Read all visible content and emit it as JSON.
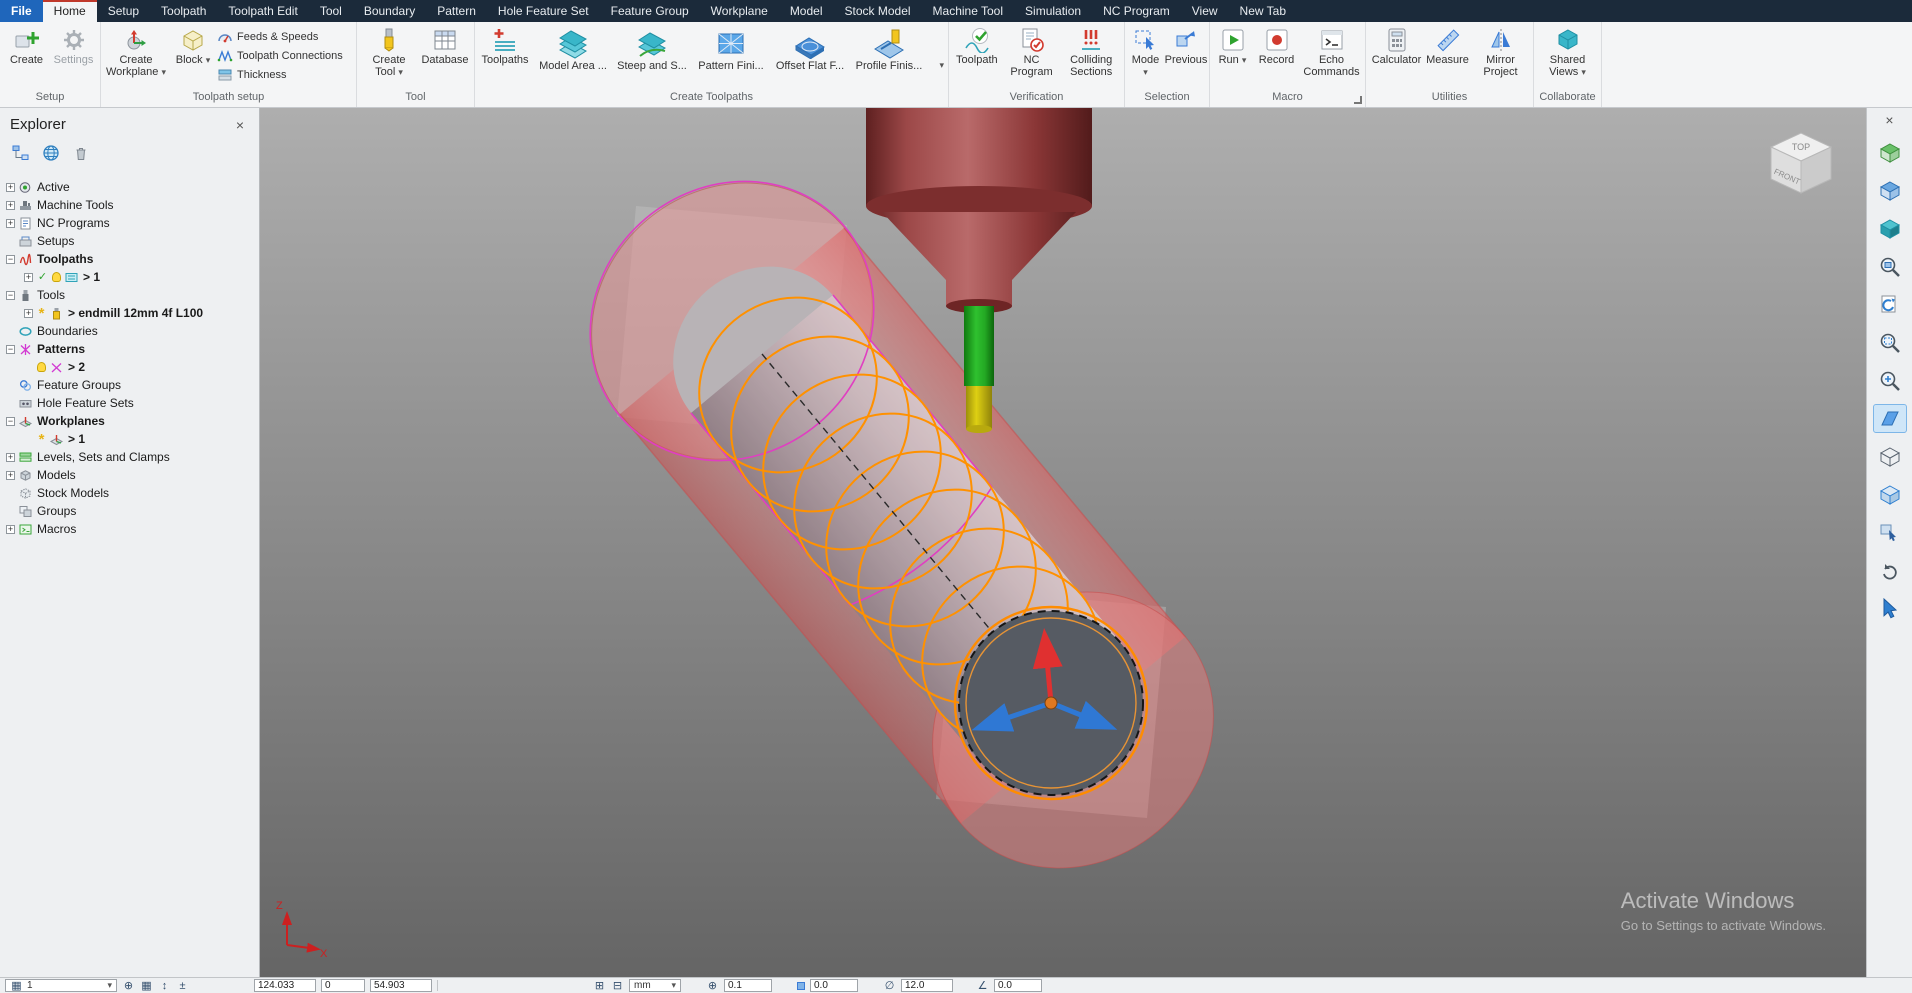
{
  "tab_bar": {
    "tabs": [
      "File",
      "Home",
      "Setup",
      "Toolpath",
      "Toolpath Edit",
      "Tool",
      "Boundary",
      "Pattern",
      "Hole Feature Set",
      "Feature Group",
      "Workplane",
      "Model",
      "Stock Model",
      "Machine Tool",
      "Simulation",
      "NC Program",
      "View",
      "New Tab"
    ]
  },
  "ribbon": {
    "groups": {
      "setup": {
        "label": "Setup"
      },
      "toolpath_setup": {
        "label": "Toolpath setup"
      },
      "tool": {
        "label": "Tool"
      },
      "create_toolpaths": {
        "label": "Create Toolpaths"
      },
      "verification": {
        "label": "Verification"
      },
      "selection": {
        "label": "Selection"
      },
      "macro": {
        "label": "Macro"
      },
      "utilities": {
        "label": "Utilities"
      },
      "collaborate": {
        "label": "Collaborate"
      }
    },
    "buttons": {
      "create": "Create",
      "settings": "Settings",
      "create_workplane": "Create Workplane",
      "block": "Block",
      "feeds_speeds": "Feeds & Speeds",
      "toolpath_connections": "Toolpath Connections",
      "thickness": "Thickness",
      "create_tool": "Create Tool",
      "database": "Database",
      "toolpaths": "Toolpaths",
      "model_area": "Model Area ...",
      "steep_shallow": "Steep and S...",
      "pattern_finishing": "Pattern Fini...",
      "offset_flat": "Offset Flat F...",
      "profile_finishing": "Profile Finis...",
      "verify_toolpath": "Toolpath",
      "nc_program": "NC Program",
      "colliding_sections": "Colliding Sections",
      "mode": "Mode",
      "previous": "Previous",
      "run": "Run",
      "record": "Record",
      "echo_commands": "Echo Commands",
      "calculator": "Calculator",
      "measure": "Measure",
      "mirror_project": "Mirror Project",
      "shared_views": "Shared Views"
    }
  },
  "explorer": {
    "title": "Explorer",
    "tree": [
      {
        "label": "Active"
      },
      {
        "label": "Machine Tools"
      },
      {
        "label": "NC Programs"
      },
      {
        "label": "Setups"
      },
      {
        "label": "Toolpaths"
      },
      {
        "label": "> 1"
      },
      {
        "label": "Tools"
      },
      {
        "label": "> endmill 12mm 4f L100"
      },
      {
        "label": "Boundaries"
      },
      {
        "label": "Patterns"
      },
      {
        "label": "> 2"
      },
      {
        "label": "Feature Groups"
      },
      {
        "label": "Hole Feature Sets"
      },
      {
        "label": "Workplanes"
      },
      {
        "label": "> 1"
      },
      {
        "label": "Levels, Sets and Clamps"
      },
      {
        "label": "Models"
      },
      {
        "label": "Stock Models"
      },
      {
        "label": "Groups"
      },
      {
        "label": "Macros"
      }
    ]
  },
  "viewport": {
    "view_cube": {
      "top": "TOP",
      "front": "FRONT"
    },
    "triad": {
      "z": "Z",
      "x": "X"
    },
    "watermark_line1": "Activate Windows",
    "watermark_line2": "Go to Settings to activate Windows."
  },
  "status_bar": {
    "selector_value": "1",
    "coord_x": "124.033",
    "coord_y": "0",
    "coord_z": "54.903",
    "units": "mm",
    "tolerance": "0.1",
    "thickness": "0.0",
    "tool_diameter": "12.0",
    "angle": "0.0"
  },
  "glyphs": {
    "caret": "▾",
    "close": "×",
    "plus": "+",
    "minus": "−",
    "check": "✓",
    "sparkle": "*",
    "oplus": "⊕",
    "grid": "▦",
    "updown": "↕",
    "plusminus": "±",
    "boxplus": "⊞",
    "boxminus": "⊟",
    "diameter": "∅",
    "angle": "∠",
    "undo": "↺"
  }
}
